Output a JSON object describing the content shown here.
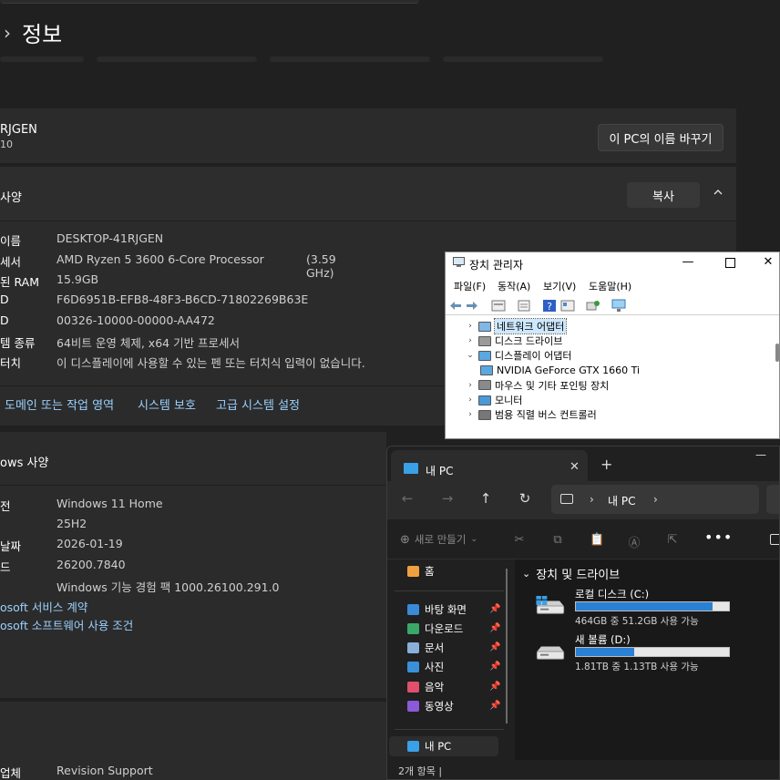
{
  "settings": {
    "breadcrumb_current": "정보",
    "pc_name_short": "RJGEN",
    "pc_name_sub": "10",
    "rename_button": "이 PC의 이름 바꾸기",
    "spec_title": "사양",
    "copy_button": "복사",
    "device_specs": [
      {
        "key": "이름",
        "value": "DESKTOP-41RJGEN",
        "extra": ""
      },
      {
        "key": "세서",
        "value": "AMD Ryzen 5 3600 6-Core Processor",
        "extra": "(3.59 GHz)"
      },
      {
        "key": "된 RAM",
        "value": "15.9GB",
        "extra": ""
      },
      {
        "key": "D",
        "value": "F6D6951B-EFB8-48F3-B6CD-71802269B63E",
        "extra": ""
      },
      {
        "key": "D",
        "value": "00326-10000-00000-AA472",
        "extra": ""
      },
      {
        "key": "템 종류",
        "value": "64비트 운영 체제, x64 기반 프로세서",
        "extra": ""
      },
      {
        "key": "터치",
        "value": "이 디스플레이에 사용할 수 있는 펜 또는 터치식 입력이 없습니다.",
        "extra": ""
      }
    ],
    "related_links": [
      "도메인 또는 작업 영역",
      "시스템 보호",
      "고급 시스템 설정"
    ],
    "windows_title": "ows 사양",
    "windows_specs": [
      {
        "key": "전",
        "value": "Windows 11 Home"
      },
      {
        "key": "",
        "value": "25H2"
      },
      {
        "key": "날짜",
        "value": "2026-01-19"
      },
      {
        "key": "드",
        "value": "26200.7840"
      },
      {
        "key": "",
        "value": "Windows 기능 경험 팩 1000.26100.291.0"
      }
    ],
    "windows_links": [
      "osoft 서비스 계약",
      "osoft 소프트웨어 사용 조건"
    ],
    "support": {
      "key": "업체",
      "value": "Revision Support"
    }
  },
  "device_manager": {
    "title": "장치 관리자",
    "menus": [
      "파일(F)",
      "동작(A)",
      "보기(V)",
      "도움말(H)"
    ],
    "tree": [
      {
        "label": "네트워크 어댑터",
        "expand": "›",
        "icon": "network",
        "indent": 0,
        "selected": true
      },
      {
        "label": "디스크 드라이브",
        "expand": "›",
        "icon": "disk",
        "indent": 0,
        "selected": false
      },
      {
        "label": "디스플레이 어댑터",
        "expand": "⌄",
        "icon": "display",
        "indent": 0,
        "selected": false
      },
      {
        "label": "NVIDIA GeForce GTX 1660 Ti",
        "expand": "",
        "icon": "display",
        "indent": 1,
        "selected": false
      },
      {
        "label": "마우스 및 기타 포인팅 장치",
        "expand": "›",
        "icon": "mouse",
        "indent": 0,
        "selected": false
      },
      {
        "label": "모니터",
        "expand": "›",
        "icon": "monitor",
        "indent": 0,
        "selected": false
      },
      {
        "label": "범용 직렬 버스 컨트롤러",
        "expand": "›",
        "icon": "usb",
        "indent": 0,
        "selected": false
      }
    ]
  },
  "explorer": {
    "tab_title": "내 PC",
    "address_parts": [
      "내 PC"
    ],
    "new_button": "새로 만들기",
    "sidebar": [
      {
        "label": "홈",
        "icon": "home",
        "pinned": false
      },
      {
        "label": "바탕 화면",
        "icon": "desktop",
        "pinned": true
      },
      {
        "label": "다운로드",
        "icon": "download",
        "pinned": true
      },
      {
        "label": "문서",
        "icon": "document",
        "pinned": true
      },
      {
        "label": "사진",
        "icon": "pictures",
        "pinned": true
      },
      {
        "label": "음악",
        "icon": "music",
        "pinned": true
      },
      {
        "label": "동영상",
        "icon": "videos",
        "pinned": true
      },
      {
        "label": "내 PC",
        "icon": "pc",
        "pinned": false
      }
    ],
    "group_title": "장치 및 드라이브",
    "drives": [
      {
        "name": "로컬 디스크 (C:)",
        "info": "464GB 중 51.2GB 사용 가능",
        "used_fraction": 0.89,
        "icon": "windows-drive"
      },
      {
        "name": "새 볼륨 (D:)",
        "info": "1.81TB 중 1.13TB 사용 가능",
        "used_fraction": 0.38,
        "icon": "drive"
      }
    ],
    "status_text": "2개 항목  |"
  },
  "colors": {
    "link": "#9ad1ff",
    "drive_fill": "#2a80d2",
    "accent": "#3aa0e8"
  }
}
